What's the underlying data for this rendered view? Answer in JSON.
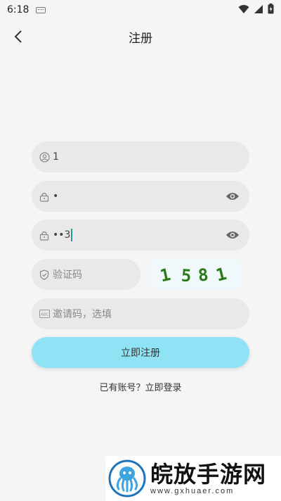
{
  "status_bar": {
    "time": "6:18"
  },
  "app_bar": {
    "title": "注册"
  },
  "form": {
    "username": {
      "value": "1"
    },
    "password": {
      "value": "•"
    },
    "confirm_password": {
      "value": "••3"
    },
    "captcha": {
      "placeholder": "验证码",
      "image_text": "1 5 8 1"
    },
    "invite_code": {
      "placeholder": "邀请码，选填"
    }
  },
  "actions": {
    "register_label": "立即注册",
    "login_prompt": "已有账号？立即登录"
  },
  "watermark": {
    "title": "皖放手游网",
    "url": "www.gxhuaer.com"
  },
  "colors": {
    "button": "#8fe3f5",
    "background": "#f5f5f5",
    "field": "#e9e9e9",
    "captcha_text": "#2a7a1a"
  }
}
